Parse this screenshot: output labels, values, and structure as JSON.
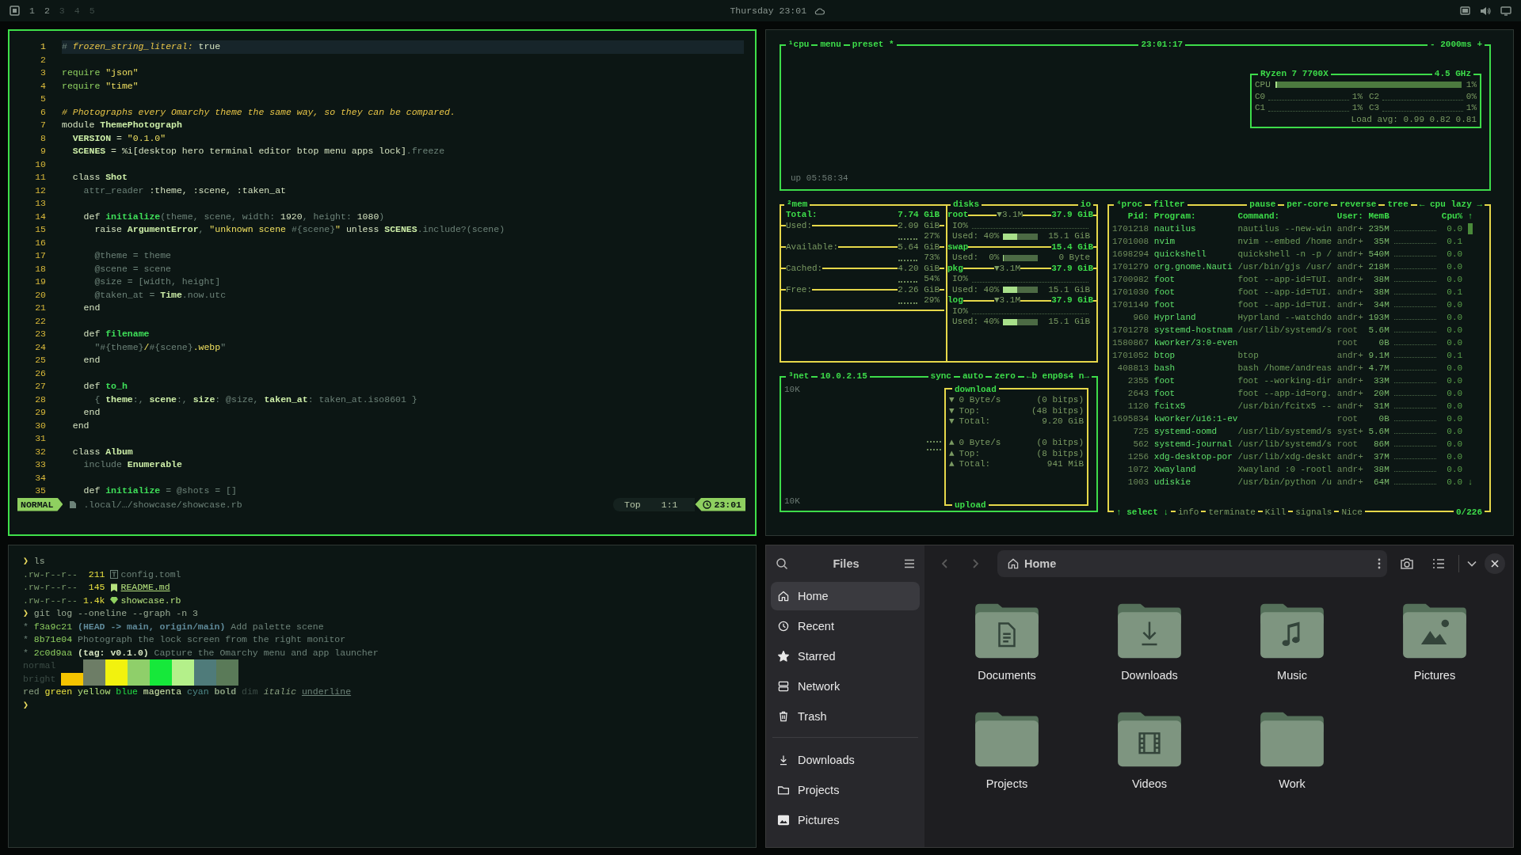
{
  "top_bar": {
    "workspaces": [
      {
        "label": "1",
        "occupied": true
      },
      {
        "label": "2",
        "occupied": true
      },
      {
        "label": "3",
        "occupied": false
      },
      {
        "label": "4",
        "occupied": false
      },
      {
        "label": "5",
        "occupied": false
      }
    ],
    "clock": "Thursday 23:01"
  },
  "editor": {
    "lines": [
      {
        "number": "1",
        "current": true,
        "tokens": [
          {
            "kind": "dim",
            "text": "#"
          },
          {
            "kind": "comment",
            "text": " frozen_string_literal:"
          },
          {
            "kind": "plain",
            "text": " true"
          }
        ]
      },
      {
        "number": "2",
        "current": false
      },
      {
        "number": "3",
        "current": false,
        "tokens": [
          {
            "kind": "keyword",
            "text": "require "
          },
          {
            "kind": "string",
            "text": "\"json\""
          }
        ]
      },
      {
        "number": "4",
        "current": false,
        "tokens": [
          {
            "kind": "keyword",
            "text": "require "
          },
          {
            "kind": "string",
            "text": "\"time\""
          }
        ]
      },
      {
        "number": "5",
        "current": false
      },
      {
        "number": "6",
        "current": false,
        "tokens": [
          {
            "kind": "comment",
            "text": "# Photographs every Omarchy theme the same way, so they can be compared."
          }
        ]
      },
      {
        "number": "7",
        "current": false,
        "tokens": [
          {
            "kind": "plain",
            "text": "module "
          },
          {
            "kind": "const",
            "text": "ThemePhotograph"
          }
        ]
      },
      {
        "number": "8",
        "current": false,
        "tokens": [
          {
            "kind": "const",
            "text": "  VERSION"
          },
          {
            "kind": "plain",
            "text": " = "
          },
          {
            "kind": "string",
            "text": "\"0.1.0\""
          }
        ]
      },
      {
        "number": "9",
        "current": false,
        "tokens": [
          {
            "kind": "const",
            "text": "  SCENES"
          },
          {
            "kind": "plain",
            "text": " = %i[desktop hero terminal editor btop menu apps lock]"
          },
          {
            "kind": "dim",
            "text": ".freeze"
          }
        ]
      },
      {
        "number": "10",
        "current": false
      },
      {
        "number": "11",
        "current": false,
        "tokens": [
          {
            "kind": "plain",
            "text": "  class "
          },
          {
            "kind": "const",
            "text": "Shot"
          }
        ]
      },
      {
        "number": "12",
        "current": false,
        "tokens": [
          {
            "kind": "dim",
            "text": "    attr_reader "
          },
          {
            "kind": "plain",
            "text": ":theme, :scene, :taken_at"
          }
        ]
      },
      {
        "number": "13",
        "current": false
      },
      {
        "number": "14",
        "current": false,
        "tokens": [
          {
            "kind": "plain",
            "text": "    def "
          },
          {
            "kind": "function",
            "text": "initialize"
          },
          {
            "kind": "dim",
            "text": "(theme, scene, width: "
          },
          {
            "kind": "plain",
            "text": "1920"
          },
          {
            "kind": "dim",
            "text": ", height: "
          },
          {
            "kind": "plain",
            "text": "1080"
          },
          {
            "kind": "dim",
            "text": ")"
          }
        ]
      },
      {
        "number": "15",
        "current": false,
        "tokens": [
          {
            "kind": "plain",
            "text": "      raise "
          },
          {
            "kind": "const",
            "text": "ArgumentError"
          },
          {
            "kind": "dim",
            "text": ", "
          },
          {
            "kind": "string",
            "text": "\"unknown scene "
          },
          {
            "kind": "dim",
            "text": "#{scene}"
          },
          {
            "kind": "string",
            "text": "\""
          },
          {
            "kind": "plain",
            "text": " unless "
          },
          {
            "kind": "const",
            "text": "SCENES"
          },
          {
            "kind": "dim",
            "text": ".include?(scene)"
          }
        ]
      },
      {
        "number": "16",
        "current": false
      },
      {
        "number": "17",
        "current": false,
        "tokens": [
          {
            "kind": "dim",
            "text": "      @theme = theme"
          }
        ]
      },
      {
        "number": "18",
        "current": false,
        "tokens": [
          {
            "kind": "dim",
            "text": "      @scene = scene"
          }
        ]
      },
      {
        "number": "19",
        "current": false,
        "tokens": [
          {
            "kind": "dim",
            "text": "      @size = [width, height]"
          }
        ]
      },
      {
        "number": "20",
        "current": false,
        "tokens": [
          {
            "kind": "dim",
            "text": "      @taken_at = "
          },
          {
            "kind": "const",
            "text": "Time"
          },
          {
            "kind": "dim",
            "text": ".now.utc"
          }
        ]
      },
      {
        "number": "21",
        "current": false,
        "tokens": [
          {
            "kind": "plain",
            "text": "    end"
          }
        ]
      },
      {
        "number": "22",
        "current": false
      },
      {
        "number": "23",
        "current": false,
        "tokens": [
          {
            "kind": "plain",
            "text": "    def "
          },
          {
            "kind": "function",
            "text": "filename"
          }
        ]
      },
      {
        "number": "24",
        "current": false,
        "tokens": [
          {
            "kind": "dim",
            "text": "      \"#{theme}"
          },
          {
            "kind": "string",
            "text": "/"
          },
          {
            "kind": "dim",
            "text": "#{scene}"
          },
          {
            "kind": "string",
            "text": ".webp"
          },
          {
            "kind": "dim",
            "text": "\""
          }
        ]
      },
      {
        "number": "25",
        "current": false,
        "tokens": [
          {
            "kind": "plain",
            "text": "    end"
          }
        ]
      },
      {
        "number": "26",
        "current": false
      },
      {
        "number": "27",
        "current": false,
        "tokens": [
          {
            "kind": "plain",
            "text": "    def "
          },
          {
            "kind": "function",
            "text": "to_h"
          }
        ]
      },
      {
        "number": "28",
        "current": false,
        "tokens": [
          {
            "kind": "dim",
            "text": "      { "
          },
          {
            "kind": "const",
            "text": "theme"
          },
          {
            "kind": "dim",
            "text": ":, "
          },
          {
            "kind": "const",
            "text": "scene"
          },
          {
            "kind": "dim",
            "text": ":, "
          },
          {
            "kind": "const",
            "text": "size"
          },
          {
            "kind": "dim",
            "text": ": @size, "
          },
          {
            "kind": "const",
            "text": "taken_at"
          },
          {
            "kind": "dim",
            "text": ": taken_at.iso8601 }"
          }
        ]
      },
      {
        "number": "29",
        "current": false,
        "tokens": [
          {
            "kind": "plain",
            "text": "    end"
          }
        ]
      },
      {
        "number": "30",
        "current": false,
        "tokens": [
          {
            "kind": "plain",
            "text": "  end"
          }
        ]
      },
      {
        "number": "31",
        "current": false
      },
      {
        "number": "32",
        "current": false,
        "tokens": [
          {
            "kind": "plain",
            "text": "  class "
          },
          {
            "kind": "const",
            "text": "Album"
          }
        ]
      },
      {
        "number": "33",
        "current": false,
        "tokens": [
          {
            "kind": "dim",
            "text": "    include "
          },
          {
            "kind": "const",
            "text": "Enumerable"
          }
        ]
      },
      {
        "number": "34",
        "current": false
      },
      {
        "number": "35",
        "current": false,
        "tokens": [
          {
            "kind": "plain",
            "text": "    def "
          },
          {
            "kind": "function",
            "text": "initialize"
          },
          {
            "kind": "dim",
            "text": " = @shots = []"
          }
        ]
      }
    ],
    "status": {
      "mode": "NORMAL",
      "path": ".local/…/showcase/showcase.rb",
      "position": "Top",
      "cursor": "1:1",
      "clock": "23:01"
    }
  },
  "btop": {
    "cpu": {
      "tabs": [
        "¹cpu",
        "menu",
        "preset *"
      ],
      "clock": "23:01:17",
      "interval": "- 2000ms +",
      "uptime": "up 05:58:34",
      "info": {
        "model": "Ryzen 7 7700X",
        "frequency": "4.5 GHz",
        "total_label": "CPU",
        "level": 0.01,
        "total": "1%",
        "cores": [
          {
            "label": "C0",
            "value": "1%"
          },
          {
            "label": "C2",
            "value": "0%"
          },
          {
            "label": "C1",
            "value": "1%"
          },
          {
            "label": "C3",
            "value": "1%"
          }
        ],
        "load": "Load avg: 0.99 0.82 0.81"
      }
    },
    "mem": {
      "title": "²mem",
      "items": [
        {
          "kind": "total",
          "label": "Total:",
          "value": "7.74 GiB"
        },
        {
          "kind": "meter",
          "label": "Used:",
          "value": "2.09 GiB",
          "percent": "27%"
        },
        {
          "kind": "meter",
          "label": "Available:",
          "value": "5.64 GiB",
          "percent": "73%"
        },
        {
          "kind": "meter",
          "label": "Cached:",
          "value": "4.20 GiB",
          "percent": "54%"
        },
        {
          "kind": "meter",
          "label": "Free:",
          "value": "2.26 GiB",
          "percent": "29%"
        }
      ]
    },
    "disks": {
      "title": "disks",
      "io_tab": "io",
      "items": [
        {
          "name": "root",
          "rate": "▼3.1M",
          "size": "37.9 GiB",
          "io": "IO%",
          "used": "Used: 40%",
          "level": 0.4,
          "used_size": "15.1 GiB"
        },
        {
          "name": "swap",
          "size": "15.4 GiB",
          "used": "Used:  0%",
          "level": 0,
          "used_size": "0 Byte"
        },
        {
          "name": "pkg",
          "rate": "▼3.1M",
          "size": "37.9 GiB",
          "io": "IO%",
          "used": "Used: 40%",
          "level": 0.4,
          "used_size": "15.1 GiB"
        },
        {
          "name": "log",
          "rate": "▼3.1M",
          "size": "37.9 GiB",
          "io": "IO%",
          "used": "Used: 40%",
          "level": 0.4,
          "used_size": "15.1 GiB"
        }
      ]
    },
    "net": {
      "tabs": [
        "³net",
        "10.0.2.15"
      ],
      "right_tabs": [
        "sync",
        "auto",
        "zero",
        "←b enp0s4 n→"
      ],
      "scale_top": "10K",
      "scale_bottom": "10K",
      "download_title": "download",
      "upload_title": "upload",
      "download": [
        {
          "arrow": "▼",
          "label": "0 Byte/s",
          "value": "(0 bitps)"
        },
        {
          "arrow": "▼",
          "label": "Top:",
          "value": "(48 bitps)"
        },
        {
          "arrow": "▼",
          "label": "Total:",
          "value": "9.20 GiB"
        }
      ],
      "upload": [
        {
          "arrow": "▲",
          "label": "0 Byte/s",
          "value": "(0 bitps)"
        },
        {
          "arrow": "▲",
          "label": "Top:",
          "value": "(8 bitps)"
        },
        {
          "arrow": "▲",
          "label": "Total:",
          "value": "941 MiB"
        }
      ]
    },
    "proc": {
      "tabs": [
        "⁴proc",
        "filter"
      ],
      "right_tabs": [
        "pause",
        "per-core",
        "reverse",
        "tree",
        "← cpu lazy →"
      ],
      "columns": [
        "Pid:",
        "Program:",
        "Command:",
        "User:",
        "MemB",
        "Cpu%"
      ],
      "sort_arrow": "↑",
      "scroll_down": "↓",
      "rows": [
        {
          "pid": "1701218",
          "program": "nautilus",
          "command": "nautilus --new-win",
          "user": "andr+",
          "mem": "235M",
          "cpu": "0.0"
        },
        {
          "pid": "1701008",
          "program": "nvim",
          "command": "nvim --embed /home",
          "user": "andr+",
          "mem": "35M",
          "cpu": "0.1"
        },
        {
          "pid": "1698294",
          "program": "quickshell",
          "command": "quickshell -n -p /",
          "user": "andr+",
          "mem": "540M",
          "cpu": "0.0"
        },
        {
          "pid": "1701279",
          "program": "org.gnome.Nauti",
          "command": "/usr/bin/gjs /usr/",
          "user": "andr+",
          "mem": "218M",
          "cpu": "0.0"
        },
        {
          "pid": "1700982",
          "program": "foot",
          "command": "foot --app-id=TUI.",
          "user": "andr+",
          "mem": "38M",
          "cpu": "0.0"
        },
        {
          "pid": "1701030",
          "program": "foot",
          "command": "foot --app-id=TUI.",
          "user": "andr+",
          "mem": "38M",
          "cpu": "0.1"
        },
        {
          "pid": "1701149",
          "program": "foot",
          "command": "foot --app-id=TUI.",
          "user": "andr+",
          "mem": "34M",
          "cpu": "0.0"
        },
        {
          "pid": "960",
          "program": "Hyprland",
          "command": "Hyprland --watchdo",
          "user": "andr+",
          "mem": "193M",
          "cpu": "0.0"
        },
        {
          "pid": "1701278",
          "program": "systemd-hostnam",
          "command": "/usr/lib/systemd/s",
          "user": "root",
          "mem": "5.6M",
          "cpu": "0.0"
        },
        {
          "pid": "1580867",
          "program": "kworker/3:0-even",
          "user": "root",
          "mem": "0B",
          "cpu": "0.0"
        },
        {
          "pid": "1701052",
          "program": "btop",
          "command": "btop",
          "user": "andr+",
          "mem": "9.1M",
          "cpu": "0.1"
        },
        {
          "pid": "408813",
          "program": "bash",
          "command": "bash /home/andreas",
          "user": "andr+",
          "mem": "4.7M",
          "cpu": "0.0"
        },
        {
          "pid": "2355",
          "program": "foot",
          "command": "foot --working-dir",
          "user": "andr+",
          "mem": "33M",
          "cpu": "0.0"
        },
        {
          "pid": "2643",
          "program": "foot",
          "command": "foot --app-id=org.",
          "user": "andr+",
          "mem": "20M",
          "cpu": "0.0"
        },
        {
          "pid": "1120",
          "program": "fcitx5",
          "command": "/usr/bin/fcitx5 --",
          "user": "andr+",
          "mem": "31M",
          "cpu": "0.0"
        },
        {
          "pid": "1695834",
          "program": "kworker/u16:1-ev",
          "user": "root",
          "mem": "0B",
          "cpu": "0.0"
        },
        {
          "pid": "725",
          "program": "systemd-oomd",
          "command": "/usr/lib/systemd/s",
          "user": "syst+",
          "mem": "5.6M",
          "cpu": "0.0"
        },
        {
          "pid": "562",
          "program": "systemd-journal",
          "command": "/usr/lib/systemd/s",
          "user": "root",
          "mem": "86M",
          "cpu": "0.0"
        },
        {
          "pid": "1256",
          "program": "xdg-desktop-por",
          "command": "/usr/lib/xdg-deskt",
          "user": "andr+",
          "mem": "37M",
          "cpu": "0.0"
        },
        {
          "pid": "1072",
          "program": "Xwayland",
          "command": "Xwayland :0 -rootl",
          "user": "andr+",
          "mem": "38M",
          "cpu": "0.0"
        },
        {
          "pid": "1003",
          "program": "udiskie",
          "command": "/usr/bin/python /u",
          "user": "andr+",
          "mem": "64M",
          "cpu": "0.0"
        }
      ],
      "footer": [
        "↑ select ↓",
        "info",
        "terminate",
        "Kill",
        "signals",
        "Nice"
      ],
      "count": "0/226"
    }
  },
  "terminal": {
    "blocks": [
      {
        "kind": "command",
        "prompt": "❯",
        "text": "ls"
      },
      {
        "kind": "toml",
        "perms": ".rw-r--r--",
        "size": "211",
        "name": "config.toml"
      },
      {
        "kind": "markdown",
        "perms": ".rw-r--r--",
        "size": "145",
        "name": "README.md"
      },
      {
        "kind": "ruby",
        "perms": ".rw-r--r--",
        "size": "1.4k",
        "name": "showcase.rb"
      },
      {
        "kind": "command",
        "prompt": "❯",
        "text": "git log --oneline --graph -n 3"
      },
      {
        "kind": "commit",
        "graph": "*",
        "hash": "f3a9c21",
        "refs": {
          "kind": "branch",
          "text": "(HEAD -> main, origin/main)"
        },
        "message": "Add palette scene"
      },
      {
        "kind": "commit",
        "graph": "*",
        "hash": "8b71e04",
        "message": "Photograph the lock screen from the right monitor"
      },
      {
        "kind": "commit",
        "graph": "*",
        "hash": "2c0d9aa",
        "refs": {
          "kind": "tag",
          "text": "(tag: v0.1.0)"
        },
        "message": "Capture the Omarchy menu and app launcher"
      },
      {
        "kind": "palette",
        "label": "normal",
        "swatches": [
          {
            "color": "#6d7d66"
          },
          {
            "color": "#f2f20e"
          },
          {
            "color": "#8fcf6a"
          },
          {
            "color": "#16e83a"
          },
          {
            "color": "#b4f08a"
          },
          {
            "color": "#4f7b7a"
          },
          {
            "color": "#5a7a58"
          }
        ]
      },
      {
        "kind": "palette",
        "label": "bright",
        "swatches": [
          {
            "color": "#f5c400"
          },
          {
            "color": "#6d7d66"
          },
          {
            "color": "#f2f20e"
          },
          {
            "color": "#8fcf6a"
          },
          {
            "color": "#16e83a"
          },
          {
            "color": "#b4f08a"
          },
          {
            "color": "#4f7b7a"
          },
          {
            "color": "#5a7a58"
          }
        ]
      },
      {
        "kind": "styles",
        "words": [
          {
            "kind": "red",
            "text": "red"
          },
          {
            "kind": "green",
            "text": "green"
          },
          {
            "kind": "yellow",
            "text": "yellow"
          },
          {
            "kind": "blue",
            "text": "blue"
          },
          {
            "kind": "magenta",
            "text": "magenta"
          },
          {
            "kind": "cyan",
            "text": "cyan"
          },
          {
            "kind": "bold",
            "text": "bold"
          },
          {
            "kind": "dim",
            "text": "dim"
          },
          {
            "kind": "italic",
            "text": "italic"
          },
          {
            "kind": "underline",
            "text": "underline"
          }
        ]
      },
      {
        "kind": "command",
        "prompt": "❯"
      }
    ]
  },
  "files": {
    "title": "Files",
    "places": [
      {
        "label": "Home",
        "kind": "home",
        "selected": true
      },
      {
        "label": "Recent",
        "kind": "recent",
        "selected": false
      },
      {
        "label": "Starred",
        "kind": "starred",
        "selected": false
      },
      {
        "label": "Network",
        "kind": "network",
        "selected": false
      },
      {
        "label": "Trash",
        "kind": "trash",
        "selected": false
      }
    ],
    "bookmarks": [
      {
        "label": "Downloads",
        "kind": "downloads",
        "selected": false
      },
      {
        "label": "Projects",
        "kind": "folder",
        "selected": false
      },
      {
        "label": "Pictures",
        "kind": "pictures",
        "selected": false
      }
    ],
    "path": "Home",
    "folders": [
      {
        "name": "Documents",
        "kind": "documents"
      },
      {
        "name": "Downloads",
        "kind": "downloads"
      },
      {
        "name": "Music",
        "kind": "music"
      },
      {
        "name": "Pictures",
        "kind": "pictures"
      },
      {
        "name": "Projects",
        "kind": "plain"
      },
      {
        "name": "Videos",
        "kind": "videos"
      },
      {
        "name": "Work",
        "kind": "plain"
      }
    ]
  }
}
